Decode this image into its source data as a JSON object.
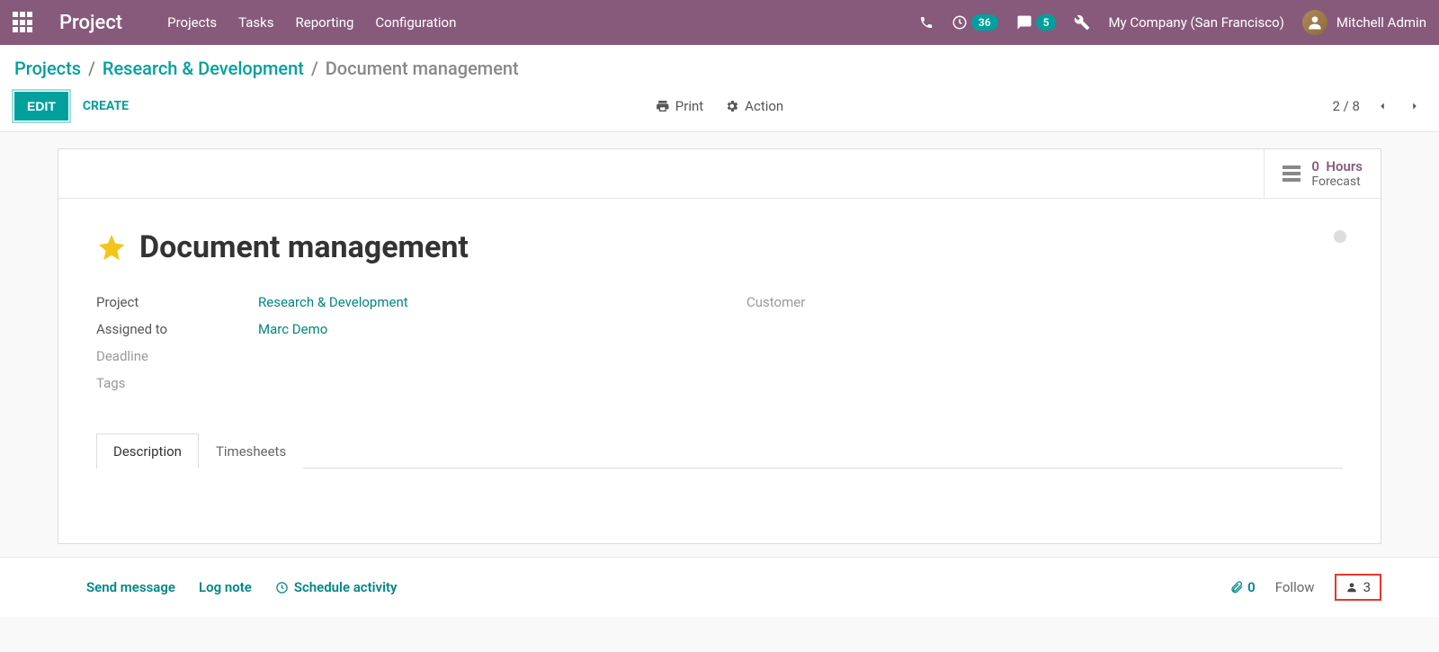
{
  "topbar": {
    "brand": "Project",
    "nav": [
      "Projects",
      "Tasks",
      "Reporting",
      "Configuration"
    ],
    "activity_count": "36",
    "chat_count": "5",
    "company": "My Company (San Francisco)",
    "user_name": "Mitchell Admin"
  },
  "breadcrumb": {
    "root": "Projects",
    "project": "Research & Development",
    "current": "Document management"
  },
  "controls": {
    "edit": "EDIT",
    "create": "CREATE",
    "print": "Print",
    "action": "Action",
    "pager": "2 / 8"
  },
  "stat": {
    "hours_value": "0",
    "hours_label": "Hours",
    "forecast": "Forecast"
  },
  "record": {
    "title": "Document management",
    "fields": {
      "project_label": "Project",
      "project_value": "Research & Development",
      "assigned_label": "Assigned to",
      "assigned_value": "Marc Demo",
      "deadline_label": "Deadline",
      "tags_label": "Tags",
      "customer_label": "Customer"
    }
  },
  "tabs": {
    "description": "Description",
    "timesheets": "Timesheets"
  },
  "chatter": {
    "send_message": "Send message",
    "log_note": "Log note",
    "schedule_activity": "Schedule activity",
    "attachments": "0",
    "follow": "Follow",
    "followers": "3"
  }
}
